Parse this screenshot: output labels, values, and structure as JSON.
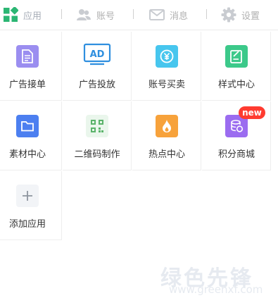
{
  "nav": {
    "items": [
      {
        "label": "应用",
        "icon": "apps-grid-icon",
        "active": true
      },
      {
        "label": "账号",
        "icon": "users-icon",
        "active": false
      },
      {
        "label": "消息",
        "icon": "mail-icon",
        "active": false
      },
      {
        "label": "设置",
        "icon": "gear-icon",
        "active": false
      }
    ]
  },
  "apps": [
    {
      "label": "广告接单",
      "icon": "document-icon",
      "color": "#9b8ef0"
    },
    {
      "label": "广告投放",
      "icon": "ad-screen-icon",
      "color": "#2f8fdf"
    },
    {
      "label": "账号买卖",
      "icon": "yuan-coin-icon",
      "color": "#47c6ee"
    },
    {
      "label": "样式中心",
      "icon": "edit-note-icon",
      "color": "#3cc98a"
    },
    {
      "label": "素材中心",
      "icon": "folder-icon",
      "color": "#4c7ff0"
    },
    {
      "label": "二维码制作",
      "icon": "qr-code-icon",
      "color": "#5ab36a"
    },
    {
      "label": "热点中心",
      "icon": "flame-icon",
      "color": "#f7a23b"
    },
    {
      "label": "积分商城",
      "icon": "coin-stack-icon",
      "color": "#9b6cf0",
      "badge": "new"
    },
    {
      "label": "添加应用",
      "icon": "plus-icon",
      "color": "#f2f4f7"
    }
  ],
  "watermark": {
    "text": "绿色先锋",
    "url": "www.greenxf.com"
  }
}
